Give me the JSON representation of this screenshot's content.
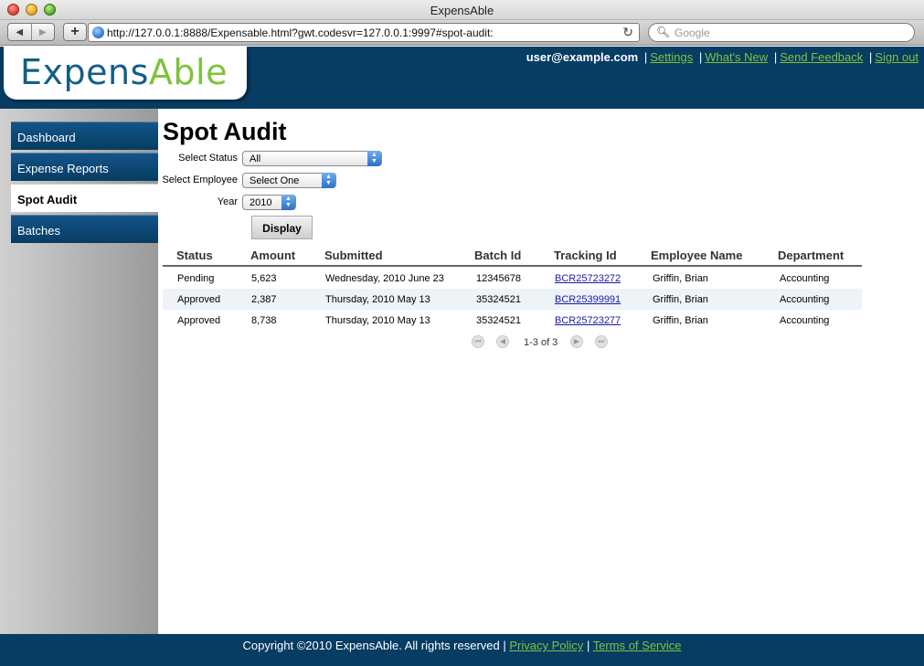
{
  "window": {
    "title": "ExpensAble"
  },
  "browser": {
    "url": "http://127.0.0.1:8888/Expensable.html?gwt.codesvr=127.0.0.1:9997#spot-audit:",
    "search_placeholder": "Google"
  },
  "header": {
    "logo_part1": "Expens",
    "logo_part2": "Able",
    "user": "user@example.com",
    "links": [
      "Settings",
      "What's New",
      "Send Feedback",
      "Sign out"
    ]
  },
  "sidebar": {
    "items": [
      {
        "label": "Dashboard"
      },
      {
        "label": "Expense Reports"
      },
      {
        "label": "Spot Audit"
      },
      {
        "label": "Batches"
      }
    ]
  },
  "main": {
    "title": "Spot Audit",
    "filters": {
      "status_label": "Select Status",
      "status_value": "All",
      "employee_label": "Select Employee",
      "employee_value": "Select One",
      "year_label": "Year",
      "year_value": "2010"
    },
    "display_button": "Display",
    "columns": [
      "Status",
      "Amount",
      "Submitted",
      "Batch Id",
      "Tracking Id",
      "Employee Name",
      "Department"
    ],
    "rows": [
      [
        "Pending",
        "5,623",
        "Wednesday, 2010 June 23",
        "12345678",
        "BCR25723272",
        "Griffin, Brian",
        "Accounting"
      ],
      [
        "Approved",
        "2,387",
        "Thursday, 2010 May 13",
        "35324521",
        "BCR25399991",
        "Griffin, Brian",
        "Accounting"
      ],
      [
        "Approved",
        "8,738",
        "Thursday, 2010 May 13",
        "35324521",
        "BCR25723277",
        "Griffin, Brian",
        "Accounting"
      ]
    ],
    "pager_text": "1-3 of 3"
  },
  "footer": {
    "copyright": "Copyright ©2010 ExpensAble. All rights reserved",
    "privacy": "Privacy Policy",
    "terms": "Terms of Service"
  },
  "colors": {
    "brand_navy": "#073c63",
    "brand_green": "#7ec33a",
    "logo_blue": "#135f86"
  }
}
